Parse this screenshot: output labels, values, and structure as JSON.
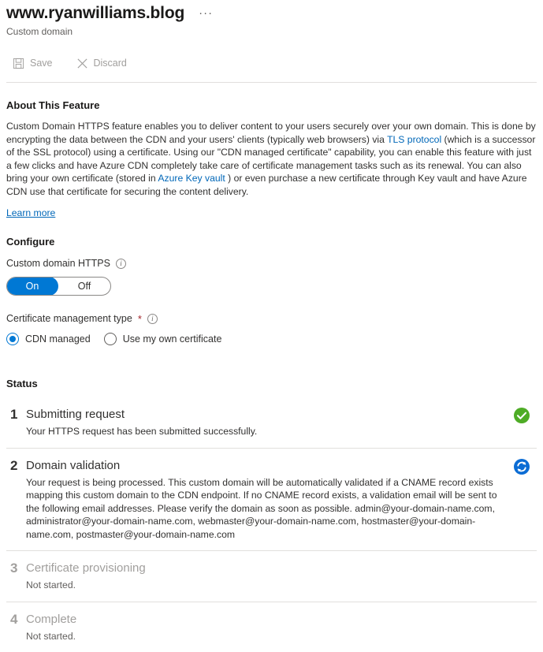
{
  "header": {
    "title": "www.ryanwilliams.blog",
    "subtitle": "Custom domain",
    "more_menu": "···"
  },
  "commandbar": {
    "save_label": "Save",
    "discard_label": "Discard"
  },
  "about": {
    "heading": "About This Feature",
    "paragraph_part1": "Custom Domain HTTPS feature enables you to deliver content to your users securely over your own domain. This is done by encrypting the data between the CDN and your users' clients (typically web browsers) via ",
    "link_tls": "TLS protocol",
    "paragraph_part2": " (which is a successor of the SSL protocol) using a certificate. Using our \"CDN managed certificate\" capability, you can enable this feature with just a few clicks and have Azure CDN completely take care of certificate management tasks such as its renewal. You can also bring your own certificate (stored in ",
    "link_keyvault": "Azure Key vault",
    "paragraph_part3": " ) or even purchase a new certificate through Key vault and have Azure CDN use that certificate for securing the content delivery.",
    "learn_more": "Learn more"
  },
  "configure": {
    "heading": "Configure",
    "https_label": "Custom domain HTTPS",
    "toggle_on": "On",
    "toggle_off": "Off",
    "toggle_value": "On",
    "cert_type_label": "Certificate management type",
    "required_mark": "*",
    "radio_cdn_managed": "CDN managed",
    "radio_own_cert": "Use my own certificate",
    "radio_selected": "CDN managed"
  },
  "status": {
    "heading": "Status",
    "steps": [
      {
        "number": "1",
        "title": "Submitting request",
        "description": "Your HTTPS request has been submitted successfully.",
        "icon": "success-check-icon",
        "state": "complete"
      },
      {
        "number": "2",
        "title": "Domain validation",
        "description": "Your request is being processed. This custom domain will be automatically validated if a CNAME record exists mapping this custom domain to the CDN endpoint. If no CNAME record exists, a validation email will be sent to the following email addresses. Please verify the domain as soon as possible. admin@your-domain-name.com, administrator@your-domain-name.com, webmaster@your-domain-name.com, hostmaster@your-domain-name.com, postmaster@your-domain-name.com",
        "icon": "sync-in-progress-icon",
        "state": "in-progress"
      },
      {
        "number": "3",
        "title": "Certificate provisioning",
        "description": "Not started.",
        "icon": "",
        "state": "not-started"
      },
      {
        "number": "4",
        "title": "Complete",
        "description": "Not started.",
        "icon": "",
        "state": "not-started"
      }
    ]
  },
  "colors": {
    "accent": "#0078d4",
    "link": "#0067b8",
    "success": "#4eac26",
    "in_progress": "#0078d4",
    "required": "#a4262c",
    "muted": "#a19f9d"
  }
}
